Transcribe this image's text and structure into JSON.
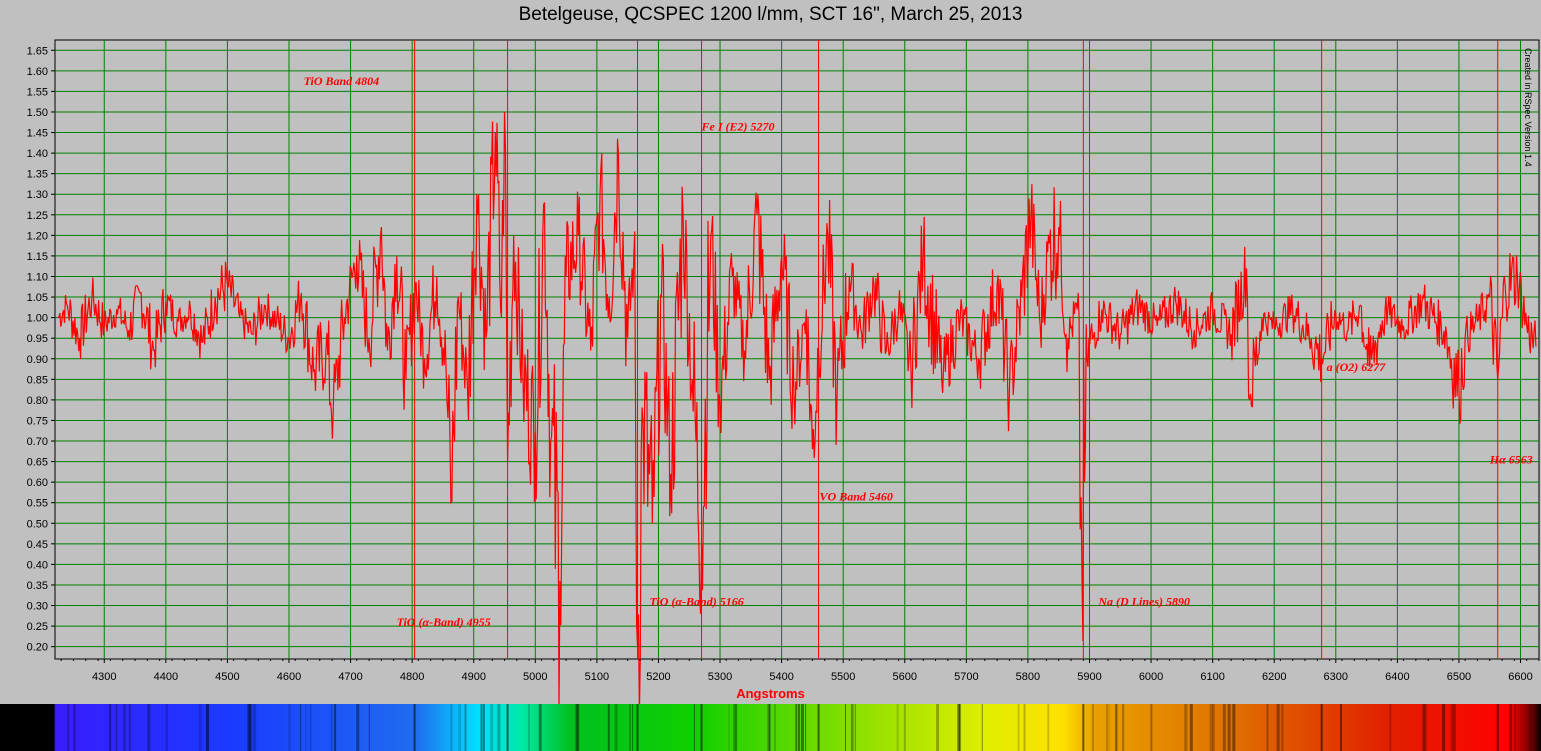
{
  "chart_data": {
    "type": "line",
    "title": "Betelgeuse, QCSPEC 1200 l/mm, SCT 16\", March 25, 2013",
    "xlabel": "Angstroms",
    "ylabel": "",
    "xlim": [
      4220,
      6630
    ],
    "ylim": [
      0.17,
      1.675
    ],
    "xticks": [
      4300,
      4400,
      4500,
      4600,
      4700,
      4800,
      4900,
      5000,
      5100,
      5200,
      5300,
      5400,
      5500,
      5600,
      5700,
      5800,
      5900,
      6000,
      6100,
      6200,
      6300,
      6400,
      6500,
      6600
    ],
    "yticks": [
      "0.20",
      "0.25",
      "0.30",
      "0.35",
      "0.40",
      "0.45",
      "0.50",
      "0.55",
      "0.60",
      "0.65",
      "0.70",
      "0.75",
      "0.80",
      "0.85",
      "0.90",
      "0.95",
      "1.00",
      "1.05",
      "1.10",
      "1.15",
      "1.20",
      "1.25",
      "1.30",
      "1.35",
      "1.40",
      "1.45",
      "1.50",
      "1.55",
      "1.60",
      "1.65"
    ],
    "grid": true,
    "series": [
      {
        "x": [
          4225,
          4240,
          4260,
          4280,
          4300,
          4320,
          4340,
          4360,
          4380,
          4400,
          4420,
          4440,
          4460,
          4480,
          4500,
          4520,
          4540,
          4560,
          4580,
          4600,
          4620,
          4640,
          4660,
          4672,
          4690,
          4710,
          4730,
          4750,
          4760,
          4775,
          4790,
          4805,
          4820,
          4840,
          4855,
          4863,
          4875,
          4890,
          4905,
          4920,
          4935,
          4945,
          4950,
          4955,
          4965,
          4980,
          5000,
          5015,
          5025,
          5040,
          5050,
          5070,
          5090,
          5105,
          5120,
          5135,
          5150,
          5160,
          5166,
          5175,
          5190,
          5205,
          5220,
          5240,
          5255,
          5270,
          5285,
          5300,
          5320,
          5340,
          5360,
          5380,
          5400,
          5420,
          5440,
          5450,
          5460,
          5475,
          5490,
          5510,
          5530,
          5550,
          5570,
          5590,
          5610,
          5630,
          5660,
          5690,
          5720,
          5750,
          5770,
          5790,
          5805,
          5820,
          5835,
          5850,
          5865,
          5880,
          5888,
          5892,
          5896,
          5905,
          5920,
          5950,
          5980,
          6010,
          6040,
          6070,
          6100,
          6130,
          6155,
          6160,
          6180,
          6200,
          6230,
          6260,
          6277,
          6300,
          6320,
          6340,
          6355,
          6380,
          6410,
          6440,
          6480,
          6500,
          6510,
          6530,
          6550,
          6563,
          6575,
          6595,
          6610,
          6625
        ],
        "y": [
          1.0,
          1.03,
          0.95,
          1.05,
          0.98,
          1.02,
          0.97,
          1.06,
          0.92,
          1.04,
          0.99,
          1.02,
          0.94,
          1.05,
          1.08,
          1.0,
          0.96,
          1.03,
          0.99,
          0.95,
          1.06,
          0.87,
          0.92,
          0.78,
          1.0,
          1.15,
          0.95,
          1.22,
          0.92,
          1.15,
          0.85,
          1.08,
          0.9,
          1.1,
          0.88,
          0.55,
          1.05,
          0.82,
          1.3,
          0.95,
          1.45,
          1.0,
          1.5,
          0.65,
          1.2,
          0.85,
          0.72,
          1.28,
          0.7,
          0.36,
          1.1,
          1.2,
          0.92,
          1.3,
          1.05,
          1.4,
          0.95,
          1.15,
          0.2,
          0.75,
          0.5,
          1.05,
          0.62,
          1.25,
          0.85,
          0.45,
          1.2,
          0.8,
          1.1,
          0.92,
          1.25,
          0.85,
          1.15,
          0.82,
          1.02,
          0.68,
          0.92,
          1.2,
          0.8,
          1.1,
          0.96,
          1.08,
          0.92,
          1.02,
          0.88,
          1.15,
          0.85,
          1.0,
          0.9,
          1.08,
          0.82,
          1.05,
          1.25,
          0.98,
          1.18,
          1.22,
          0.95,
          1.02,
          0.35,
          0.6,
          0.9,
          0.95,
          1.02,
          0.96,
          1.03,
          0.98,
          1.04,
          0.97,
          1.02,
          0.96,
          1.12,
          0.8,
          1.0,
          0.98,
          1.02,
          0.95,
          0.9,
          1.01,
          0.97,
          1.03,
          0.88,
          1.02,
          0.98,
          1.04,
          0.96,
          0.82,
          0.95,
          0.99,
          1.05,
          0.85,
          1.08,
          1.1,
          0.98,
          0.93
        ]
      }
    ],
    "annotations": [
      {
        "label": "TiO Band 4804",
        "x": 4804,
        "label_y": 1.575
      },
      {
        "label": "TiO (α-Band) 4955",
        "x": 4955,
        "label_y": 0.26
      },
      {
        "label": "TiO (α-Band) 5166",
        "x": 5166,
        "label_y": 0.31
      },
      {
        "label": "Fe I (E2) 5270",
        "x": 5270,
        "label_y": 1.465
      },
      {
        "label": "VO Band 5460",
        "x": 5460,
        "label_y": 0.565
      },
      {
        "label": "Na (D Lines) 5890",
        "x": 5890,
        "label_y": 0.31
      },
      {
        "label": "a (O2) 6277",
        "x": 6277,
        "label_y": 0.88
      },
      {
        "label": "Hα 6563",
        "x": 6563,
        "label_y": 0.655
      }
    ]
  },
  "credit": "Created in RSpec Version 1.4",
  "colors": {
    "background": "#c0c0c0",
    "plot_area": "#c0c0c0",
    "grid": "#008000",
    "series": "#ff0000",
    "marker_line": "#ff0000",
    "annotation": "#ff0000"
  }
}
